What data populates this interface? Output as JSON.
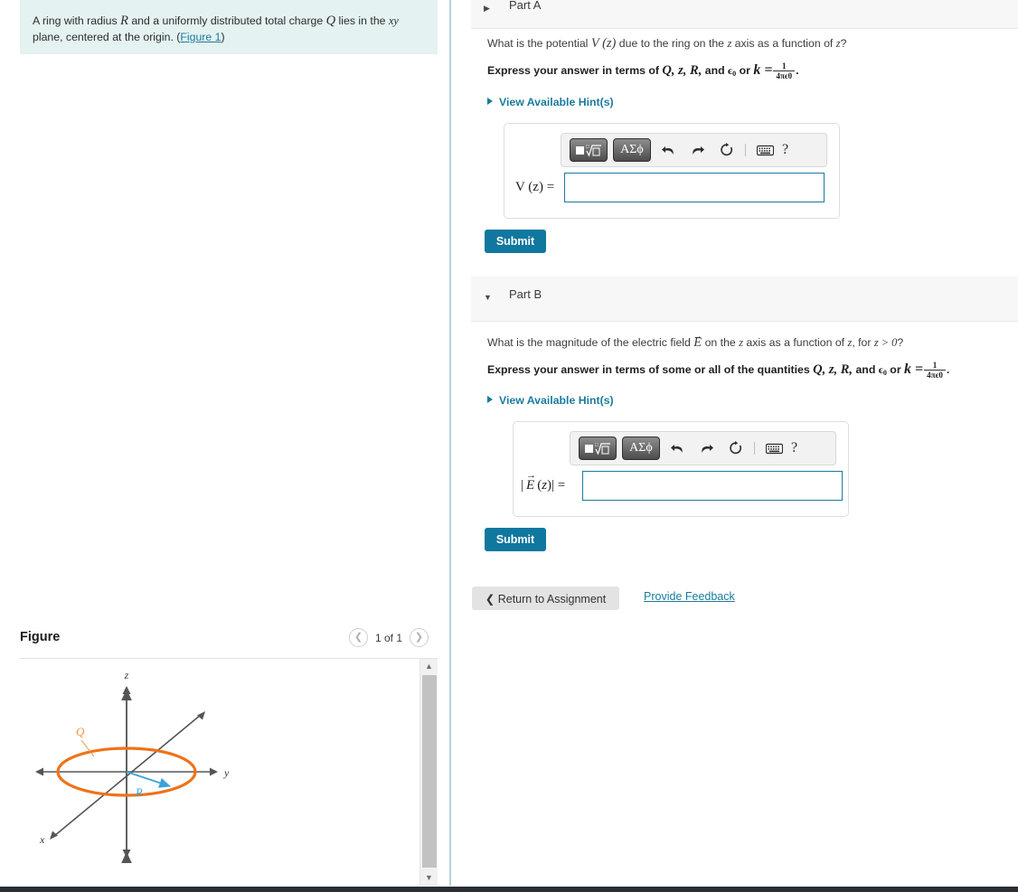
{
  "problem": {
    "text_before_R": "A ring with radius ",
    "R": "R",
    "text_mid": " and a uniformly distributed total charge ",
    "Q": "Q",
    "text_after_Q": " lies in the ",
    "xy": "xy",
    "text_line2": "plane, centered at the origin. (",
    "figure_link": "Figure 1",
    "text_end": ")"
  },
  "figure": {
    "title": "Figure",
    "pager_count": "1 of 1",
    "prev_icon": "chevron-left-icon",
    "next_icon": "chevron-right-icon",
    "diagram": {
      "axis_z": "z",
      "axis_y": "y",
      "axis_x": "x",
      "label_charge": "Q",
      "label_radius": "R",
      "ring_color": "#ee7219",
      "radius_color": "#3ba3d8",
      "axis_color": "#555555"
    },
    "scrollbar": {
      "up_icon": "scroll-up-icon",
      "down_icon": "scroll-down-icon"
    }
  },
  "parts": [
    {
      "id": "A",
      "label": "Part A",
      "caret": "caret-right",
      "question": {
        "pre": "What is the potential ",
        "symbol": "V (z)",
        "mid": " due to the ring on the ",
        "z1": "z",
        "mid2": " axis as a function of ",
        "z2": "z",
        "end": "?"
      },
      "instruction": {
        "pre": "Express your answer in terms of ",
        "vars": "Q, z, R,",
        "and": " and ",
        "eps": "ϵ0",
        "or": " or ",
        "k": "k =",
        "frac_num": "1",
        "frac_den": "4πϵ0",
        "end": "."
      },
      "hints_label": "View Available Hint(s)",
      "answer_label": "V (z) =",
      "answer_value": "",
      "submit_label": "Submit"
    },
    {
      "id": "B",
      "label": "Part B",
      "caret": "caret-down",
      "question": {
        "pre": "What is the magnitude of the electric field ",
        "symbol": "E",
        "mid": " on the ",
        "z1": "z",
        "mid2": " axis as a function of ",
        "z2": "z",
        "mid3": ", for ",
        "cond": "z > 0",
        "end": "?"
      },
      "instruction": {
        "pre": "Express your answer in terms of some or all of the quantities ",
        "vars": "Q, z, R,",
        "and": " and ",
        "eps": "ϵ0",
        "or": " or ",
        "k": "k =",
        "frac_num": "1",
        "frac_den": "4πϵ0",
        "end": "."
      },
      "hints_label": "View Available Hint(s)",
      "answer_label": "| E (z)| =",
      "answer_value": "",
      "submit_label": "Submit"
    }
  ],
  "toolbar": {
    "template_key": "√",
    "greek_key": "ΑΣϕ",
    "undo_icon": "undo-icon",
    "redo_icon": "redo-icon",
    "reset_icon": "reset-icon",
    "keyboard_icon": "keyboard-icon",
    "help_label": "?"
  },
  "footer": {
    "return_label": "Return to Assignment",
    "return_icon": "chevron-left-icon",
    "feedback_label": "Provide Feedback"
  },
  "colors": {
    "accent": "#1b7b9c",
    "submit": "#10779f",
    "problem_bg": "#e4f2f1",
    "part_header_bg": "#f7f7f7"
  }
}
